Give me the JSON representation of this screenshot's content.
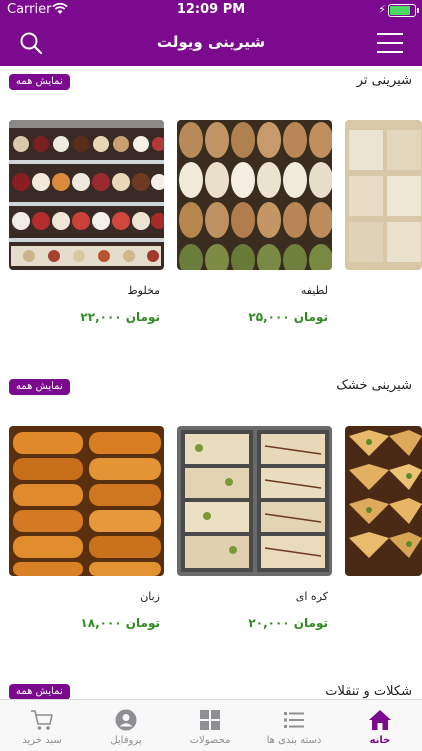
{
  "status_bar": {
    "carrier": "Carrier",
    "time": "12:09 PM"
  },
  "nav": {
    "title": "شیرینی ویولت"
  },
  "sections": [
    {
      "title": "شیرینی تر",
      "show_all": "نمایش همه",
      "products": [
        {
          "name": "مخلوط",
          "price": "۲۲,۰۰۰ تومان"
        },
        {
          "name": "لطیفه",
          "price": "۲۵,۰۰۰ تومان"
        }
      ]
    },
    {
      "title": "شیرینی خشک",
      "show_all": "نمایش همه",
      "products": [
        {
          "name": "زبان",
          "price": "۱۸,۰۰۰ تومان"
        },
        {
          "name": "کره ای",
          "price": "۲۰,۰۰۰ تومان"
        }
      ]
    },
    {
      "title": "شکلات و تنقلات",
      "show_all": "نمایش همه"
    }
  ],
  "tabs": [
    {
      "label": "سبد خرید",
      "icon": "cart-icon"
    },
    {
      "label": "پروفایل",
      "icon": "profile-icon"
    },
    {
      "label": "محصولات",
      "icon": "grid-icon"
    },
    {
      "label": "دسته بندی ها",
      "icon": "list-icon"
    },
    {
      "label": "خانه",
      "icon": "home-icon"
    }
  ],
  "colors": {
    "brand": "#7b0a8e",
    "price": "#2e8b1f",
    "active_tab": "#7b0a8e",
    "inactive_tab": "#8e8e93"
  }
}
